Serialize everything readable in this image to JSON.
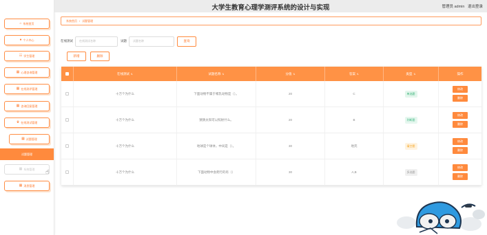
{
  "header": {
    "title": "大学生教育心理学测评系统的设计与实现",
    "user_role": "管理员 admin",
    "logout": "退出登录"
  },
  "sidebar": {
    "items": [
      {
        "label": "系统首页",
        "icon": "home-icon",
        "glyph": "⌂"
      },
      {
        "label": "个人中心",
        "icon": "user-icon",
        "glyph": "●"
      },
      {
        "label": "学生管理",
        "icon": "student-icon",
        "glyph": "☷"
      },
      {
        "label": "心理咨询管理",
        "icon": "grid-icon",
        "glyph": "▦"
      },
      {
        "label": "在线测评管理",
        "icon": "grid-icon",
        "glyph": "▦"
      },
      {
        "label": "咨询回复管理",
        "icon": "grid-icon",
        "glyph": "▦"
      },
      {
        "label": "在线测试管理",
        "icon": "trophy-icon",
        "glyph": "♛"
      },
      {
        "label": "试题管理",
        "icon": "grid-icon",
        "glyph": "▦"
      },
      {
        "label": "试题管理",
        "icon": "",
        "glyph": ""
      },
      {
        "label": "系统管理",
        "icon": "grid-icon",
        "glyph": "▦"
      },
      {
        "label": "消息管理",
        "icon": "grid-icon",
        "glyph": "▦"
      }
    ]
  },
  "breadcrumb": {
    "home": "系统首页",
    "sep": "/",
    "current": "试题管理"
  },
  "search": {
    "label1": "在线测试",
    "placeholder1": "在线测试名称",
    "label2": "试题",
    "placeholder2": "试题名称",
    "button": "查询"
  },
  "actions": {
    "add": "新增",
    "delete": "删除"
  },
  "table": {
    "headers": [
      "在线测试",
      "试题名称",
      "分值",
      "答案",
      "类型",
      "操作"
    ],
    "sort_glyph": "⇅",
    "rows": [
      {
        "test": "十万个为什么",
        "question": "下面动物不属于哺乳动物是（）。",
        "score": "20",
        "answer": "C",
        "type": "单选题",
        "type_kind": "single"
      },
      {
        "test": "十万个为什么",
        "question": "猜猜太阳可以照射什么。",
        "score": "20",
        "answer": "B",
        "type": "判断题",
        "type_kind": "multi"
      },
      {
        "test": "十万个为什么",
        "question": "地球是个球体，中间是（）。",
        "score": "30",
        "answer": "地壳",
        "type": "填空题",
        "type_kind": "judge"
      },
      {
        "test": "十万个为什么",
        "question": "下面动物中会爬行的有（）",
        "score": "30",
        "answer": "A,B",
        "type": "多选题",
        "type_kind": "fill"
      }
    ],
    "edit": "修改",
    "delete": "删除"
  }
}
